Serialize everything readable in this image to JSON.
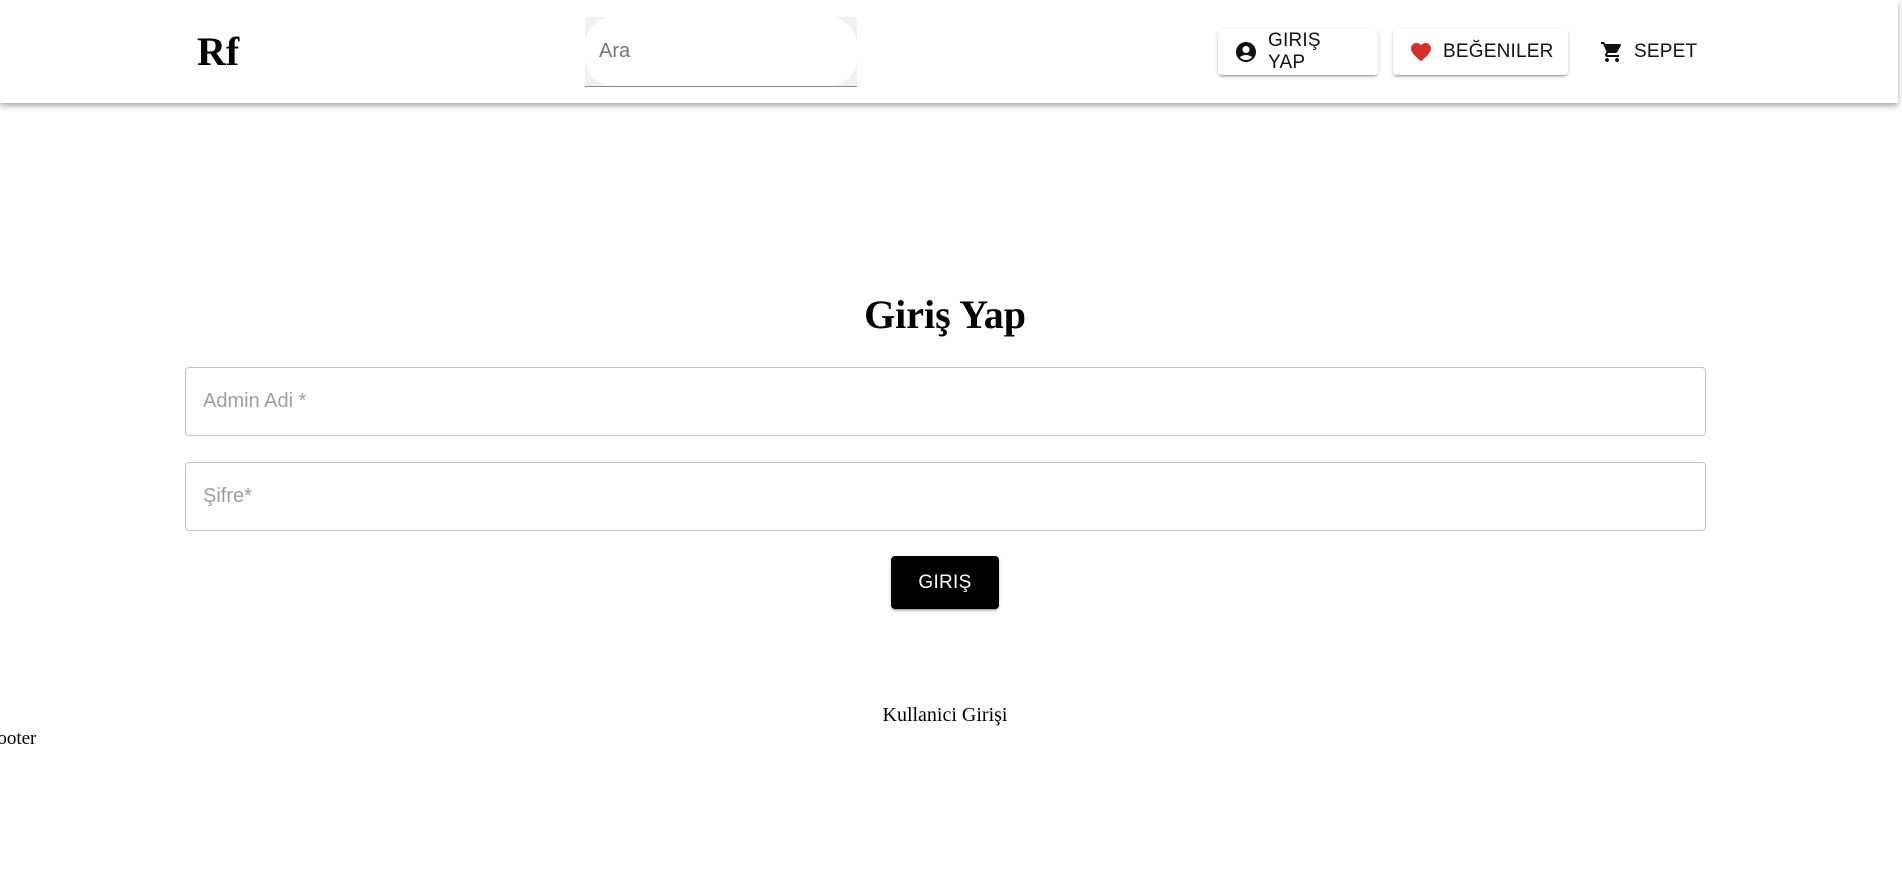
{
  "header": {
    "logo": "Rf",
    "search": {
      "placeholder": "Ara",
      "value": ""
    },
    "nav": {
      "login_label": "GIRIŞ YAP",
      "likes_label": "BEĞENILER",
      "cart_label": "SEPET"
    },
    "icons": {
      "login": "account-circle-icon",
      "likes": "heart-icon",
      "cart": "shopping-cart-icon"
    },
    "colors": {
      "heart": "#d32f2f"
    }
  },
  "main": {
    "title": "Giriş Yap",
    "username_placeholder": "Admin Adi *",
    "password_placeholder": "Şifre*",
    "submit_label": "GIRIŞ",
    "user_login_link": "Kullanici Girişi"
  },
  "footer": {
    "text": "footer"
  }
}
